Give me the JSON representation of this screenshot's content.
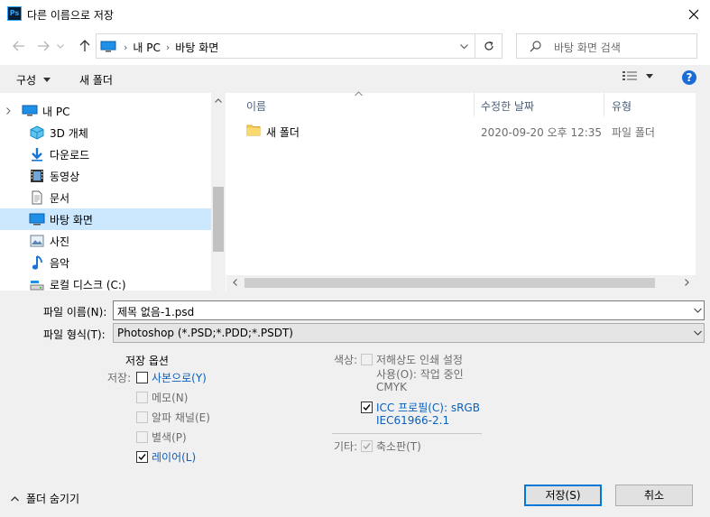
{
  "window": {
    "title": "다른 이름으로 저장",
    "app_icon_text": "Ps"
  },
  "address": {
    "crumbs": [
      "내 PC",
      "바탕 화면"
    ]
  },
  "search": {
    "placeholder": "바탕 화면 검색"
  },
  "toolbar": {
    "organize_label": "구성",
    "new_folder_label": "새 폴더",
    "help_label": "?"
  },
  "nav": {
    "items": [
      {
        "label": "내 PC",
        "icon": "pc-icon"
      },
      {
        "label": "3D 개체",
        "icon": "3d-objects-icon"
      },
      {
        "label": "다운로드",
        "icon": "download-icon"
      },
      {
        "label": "동영상",
        "icon": "video-icon"
      },
      {
        "label": "문서",
        "icon": "document-icon"
      },
      {
        "label": "바탕 화면",
        "icon": "desktop-icon",
        "selected": true
      },
      {
        "label": "사진",
        "icon": "picture-icon"
      },
      {
        "label": "음악",
        "icon": "music-icon"
      },
      {
        "label": "로컬 디스크 (C:)",
        "icon": "disk-icon"
      }
    ]
  },
  "files": {
    "columns": [
      "이름",
      "수정한 날짜",
      "유형"
    ],
    "rows": [
      {
        "name": "새 폴더",
        "modified": "2020-09-20 오후 12:35",
        "type": "파일 폴더"
      }
    ]
  },
  "form": {
    "filename_label": "파일 이름(N):",
    "filename_value": "제목 없음-1.psd",
    "filetype_label": "파일 형식(T):",
    "filetype_value": "Photoshop (*.PSD;*.PDD;*.PSDT)"
  },
  "save_options": {
    "heading": "저장 옵션",
    "save_label": "저장:",
    "as_copy": {
      "label": "사본으로(Y)",
      "checked": false
    },
    "notes": {
      "label": "메모(N)",
      "checked": false,
      "disabled": true
    },
    "alpha": {
      "label": "알파 채널(E)",
      "checked": false,
      "disabled": true
    },
    "spot": {
      "label": "별색(P)",
      "checked": false,
      "disabled": true
    },
    "layers": {
      "label": "레이어(L)",
      "checked": true
    }
  },
  "color": {
    "label": "색상:",
    "proof_line1": "저해상도 인쇄 설정",
    "proof_line2": "사용(O):  작업 중인",
    "proof_line3": "CMYK",
    "icc_line1": "ICC 프로필(C):  sRGB",
    "icc_line2": "IEC61966-2.1",
    "icc_checked": true
  },
  "other": {
    "label": "기타:",
    "thumbnail_label": "축소판(T)",
    "thumbnail_checked": true
  },
  "footer": {
    "hide_folders_label": "폴더 숨기기",
    "save_button": "저장(S)",
    "cancel_button": "취소"
  }
}
